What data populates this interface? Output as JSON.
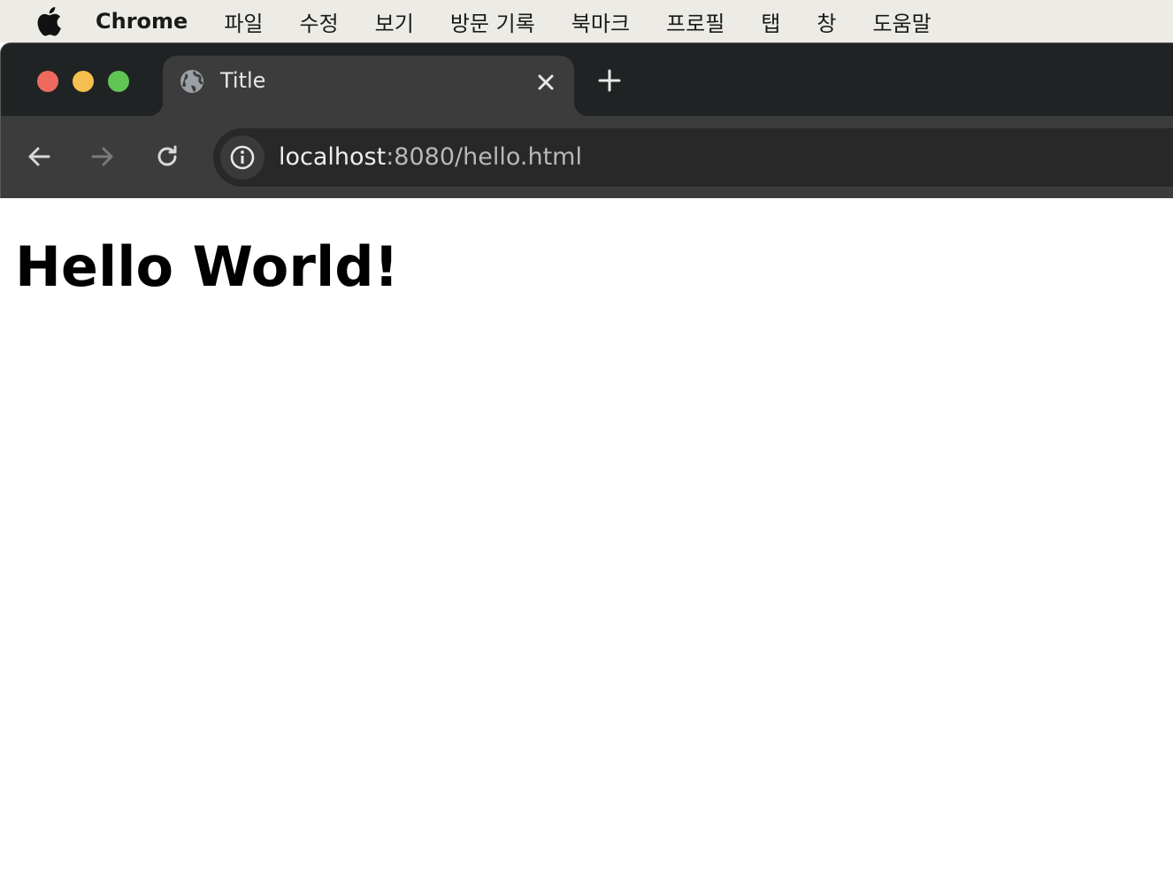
{
  "menubar": {
    "app_name": "Chrome",
    "items": [
      "파일",
      "수정",
      "보기",
      "방문 기록",
      "북마크",
      "프로필",
      "탭",
      "창",
      "도움말"
    ]
  },
  "tab": {
    "title": "Title"
  },
  "omnibox": {
    "host": "localhost",
    "path": ":8080/hello.html"
  },
  "page": {
    "heading": "Hello World!"
  },
  "colors": {
    "close": "#ee6a5e",
    "minimize": "#f5bf4f",
    "maximize": "#61c554"
  }
}
